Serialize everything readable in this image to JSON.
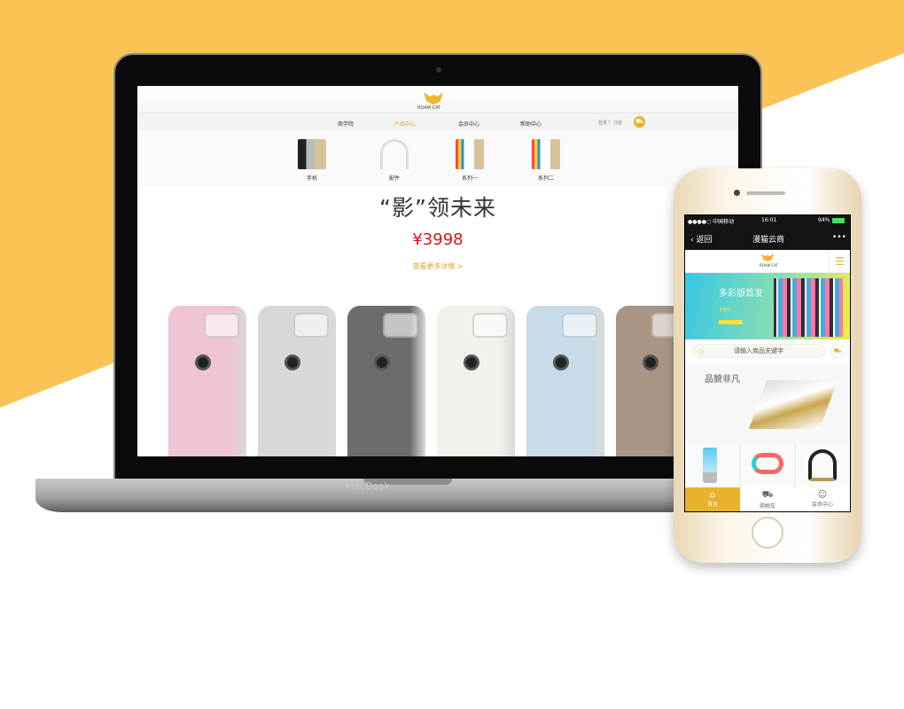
{
  "laptop": {
    "brand": "MacBook",
    "site": {
      "logo_text": "ROAM CAT",
      "nav": [
        "商学院",
        "产品中心",
        "会员中心",
        "帮助中心"
      ],
      "active_nav": "产品中心",
      "auth": {
        "login": "登录",
        "sep": "|",
        "register": "注册"
      },
      "categories": [
        "手机",
        "配件",
        "系列一",
        "系列二"
      ],
      "headline": "“影”领未来",
      "price": "¥3998",
      "more_link": "查看更多详情 >",
      "phone_colors": [
        "#efc4d6",
        "#d8d8d8",
        "#6b6b70",
        "#f3f1ec",
        "#c7dbe9",
        "#a89585"
      ]
    }
  },
  "phone": {
    "status": {
      "carrier": "●●●●○ 中国移动",
      "time": "16:01",
      "battery": "94%"
    },
    "titlebar": {
      "back": "返回",
      "title": "漫猫云商",
      "more": "•••"
    },
    "logo_text": "ROAM CAT",
    "banner": {
      "title": "多彩版首发",
      "price": "799"
    },
    "search": {
      "placeholder": "请输入商品关键字"
    },
    "promo": {
      "title": "品貌非凡"
    },
    "tabs": [
      {
        "label": "首页",
        "icon": "home-icon"
      },
      {
        "label": "购物车",
        "icon": "cart-icon"
      },
      {
        "label": "会员中心",
        "icon": "user-icon"
      }
    ],
    "accent": "#e8b22b"
  }
}
